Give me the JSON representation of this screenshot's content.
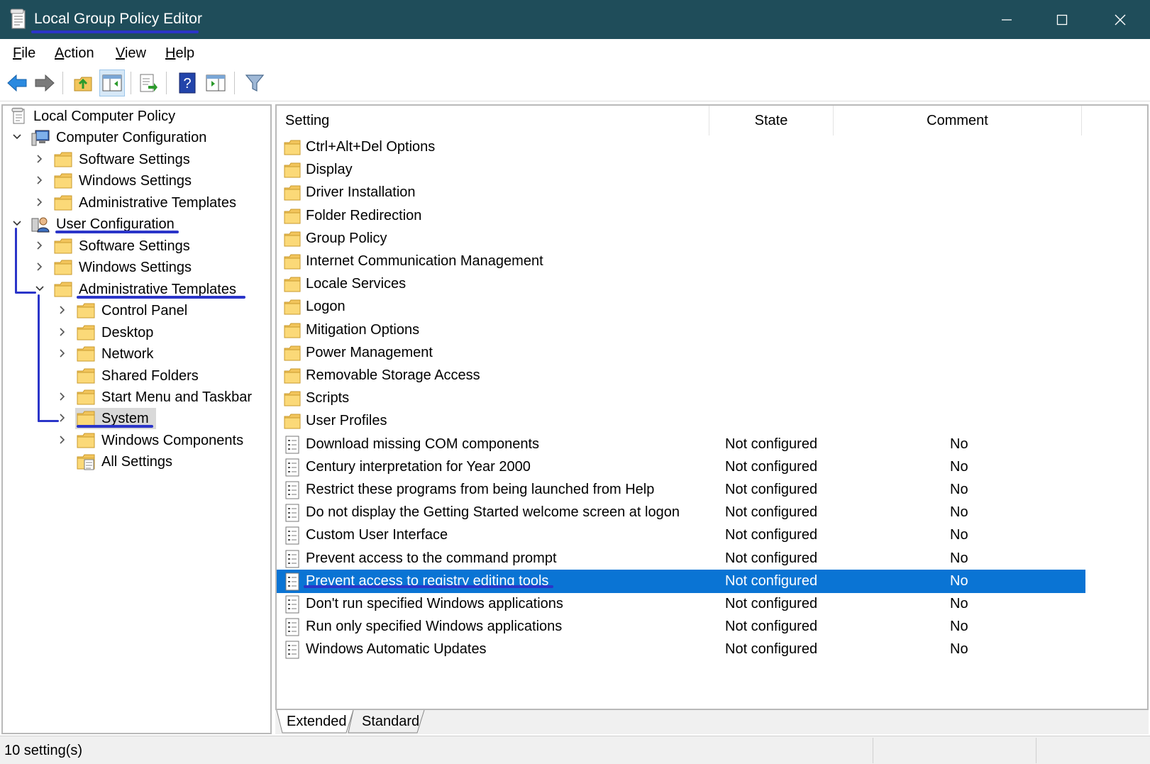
{
  "window": {
    "title": "Local Group Policy Editor",
    "buttons": [
      "minimize-icon",
      "maximize-icon",
      "close-icon"
    ]
  },
  "menu": {
    "file": {
      "accel": "F",
      "rest": "ile"
    },
    "action": {
      "accel": "A",
      "rest": "ction"
    },
    "view": {
      "accel": "V",
      "rest": "iew"
    },
    "help": {
      "accel": "H",
      "rest": "elp"
    }
  },
  "toolbar": {
    "icons": [
      "back-arrow-icon",
      "forward-arrow-icon",
      "up-folder-icon",
      "show-hide-tree-icon",
      "export-list-icon",
      "help-icon",
      "show-hide-action-pane-icon",
      "filter-icon"
    ]
  },
  "tree": {
    "root": "Local Computer Policy",
    "computer_config": "Computer Configuration",
    "cc_software": "Software Settings",
    "cc_windows": "Windows Settings",
    "cc_admin": "Administrative Templates",
    "user_config": "User Configuration",
    "uc_software": "Software Settings",
    "uc_windows": "Windows Settings",
    "uc_admin": "Administrative Templates",
    "control_panel": "Control Panel",
    "desktop": "Desktop",
    "network": "Network",
    "shared_folders": "Shared Folders",
    "start_menu": "Start Menu and Taskbar",
    "system": "System",
    "windows_components": "Windows Components",
    "all_settings": "All Settings"
  },
  "list": {
    "headers": {
      "setting": "Setting",
      "state": "State",
      "comment": "Comment"
    },
    "folders": [
      "Ctrl+Alt+Del Options",
      "Display",
      "Driver Installation",
      "Folder Redirection",
      "Group Policy",
      "Internet Communication Management",
      "Locale Services",
      "Logon",
      "Mitigation Options",
      "Power Management",
      "Removable Storage Access",
      "Scripts",
      "User Profiles"
    ],
    "settings": [
      {
        "name": "Download missing COM components",
        "state": "Not configured",
        "comment": "No"
      },
      {
        "name": "Century interpretation for Year 2000",
        "state": "Not configured",
        "comment": "No"
      },
      {
        "name": "Restrict these programs from being launched from Help",
        "state": "Not configured",
        "comment": "No"
      },
      {
        "name": "Do not display the Getting Started welcome screen at logon",
        "state": "Not configured",
        "comment": "No"
      },
      {
        "name": "Custom User Interface",
        "state": "Not configured",
        "comment": "No"
      },
      {
        "name": "Prevent access to the command prompt",
        "state": "Not configured",
        "comment": "No"
      },
      {
        "name": "Prevent access to registry editing tools",
        "state": "Not configured",
        "comment": "No"
      },
      {
        "name": "Don't run specified Windows applications",
        "state": "Not configured",
        "comment": "No"
      },
      {
        "name": "Run only specified Windows applications",
        "state": "Not configured",
        "comment": "No"
      },
      {
        "name": "Windows Automatic Updates",
        "state": "Not configured",
        "comment": "No"
      }
    ]
  },
  "tabs": {
    "extended": "Extended",
    "standard": "Standard"
  },
  "status": {
    "text": "10 setting(s)"
  },
  "colors": {
    "titlebar": "#1f4d5a",
    "selection": "#0a74d4",
    "annotation": "#2b35c9",
    "folder": "#f2c55c"
  }
}
